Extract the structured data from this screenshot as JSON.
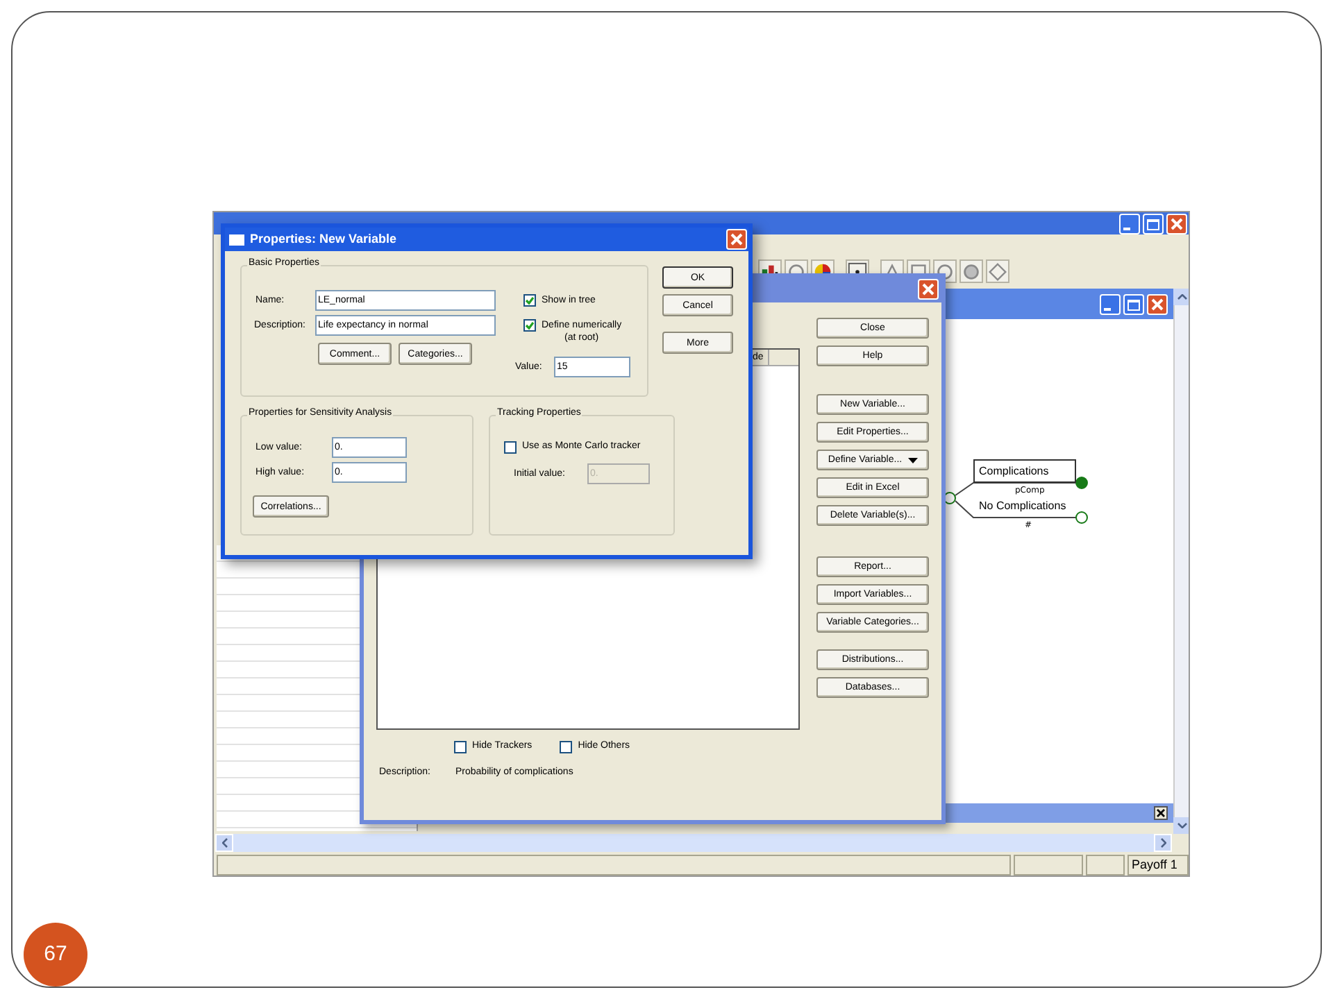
{
  "properties_dialog": {
    "title": "Properties: New Variable",
    "basic_group": {
      "title": "Basic Properties",
      "name_label": "Name:",
      "name": "LE_normal",
      "description_label": "Description:",
      "description": "Life expectancy in normal",
      "buttons": [
        "Comment...",
        "Categories..."
      ],
      "checkboxes": [
        {
          "label": "Show in tree",
          "checked": true
        },
        {
          "label": "Define numerically",
          "note": "(at root)",
          "checked": true
        }
      ],
      "value_label": "Value:",
      "value": "15"
    },
    "buttons": [
      "OK",
      "Cancel",
      "More"
    ],
    "sensitivity_group": {
      "title": "Properties for Sensitivity Analysis",
      "fields": [
        {
          "label": "Low value:",
          "value": "0."
        },
        {
          "label": "High value:",
          "value": "0."
        }
      ],
      "button": "Correlations..."
    },
    "tracking_group": {
      "title": "Tracking Properties",
      "checkbox": {
        "label": "Use as Monte Carlo tracker",
        "checked": false
      },
      "field": {
        "label": "Initial value:",
        "value": "0.",
        "disabled": true
      }
    }
  },
  "variables_dialog": {
    "list_column": "de",
    "button_groups": [
      [
        {
          "label": "Close",
          "kind": "button"
        },
        {
          "label": "Help",
          "kind": "button"
        }
      ],
      [
        {
          "label": "New Variable...",
          "kind": "button"
        },
        {
          "label": "Edit Properties...",
          "kind": "button"
        },
        {
          "label": "Define Variable...",
          "kind": "dropdown"
        },
        {
          "label": "Edit in Excel",
          "kind": "button"
        },
        {
          "label": "Delete Variable(s)...",
          "kind": "button"
        }
      ],
      [
        {
          "label": "Report...",
          "kind": "button"
        },
        {
          "label": "Import Variables...",
          "kind": "button"
        },
        {
          "label": "Variable Categories...",
          "kind": "button"
        }
      ],
      [
        {
          "label": "Distributions...",
          "kind": "button"
        },
        {
          "label": "Databases...",
          "kind": "button"
        }
      ]
    ],
    "checkboxes": [
      {
        "label": "Hide Trackers",
        "checked": false
      },
      {
        "label": "Hide Others",
        "checked": false
      }
    ],
    "description_label": "Description:",
    "description": "Probability of complications"
  },
  "tree": {
    "branches": [
      {
        "label": "Complications",
        "sublabel": "pComp",
        "selected": true
      },
      {
        "label": "No Complications",
        "sublabel": "#",
        "selected": false
      }
    ]
  },
  "status_bar": {
    "panes": [
      "Payoff 1"
    ]
  },
  "slide_number": "67"
}
